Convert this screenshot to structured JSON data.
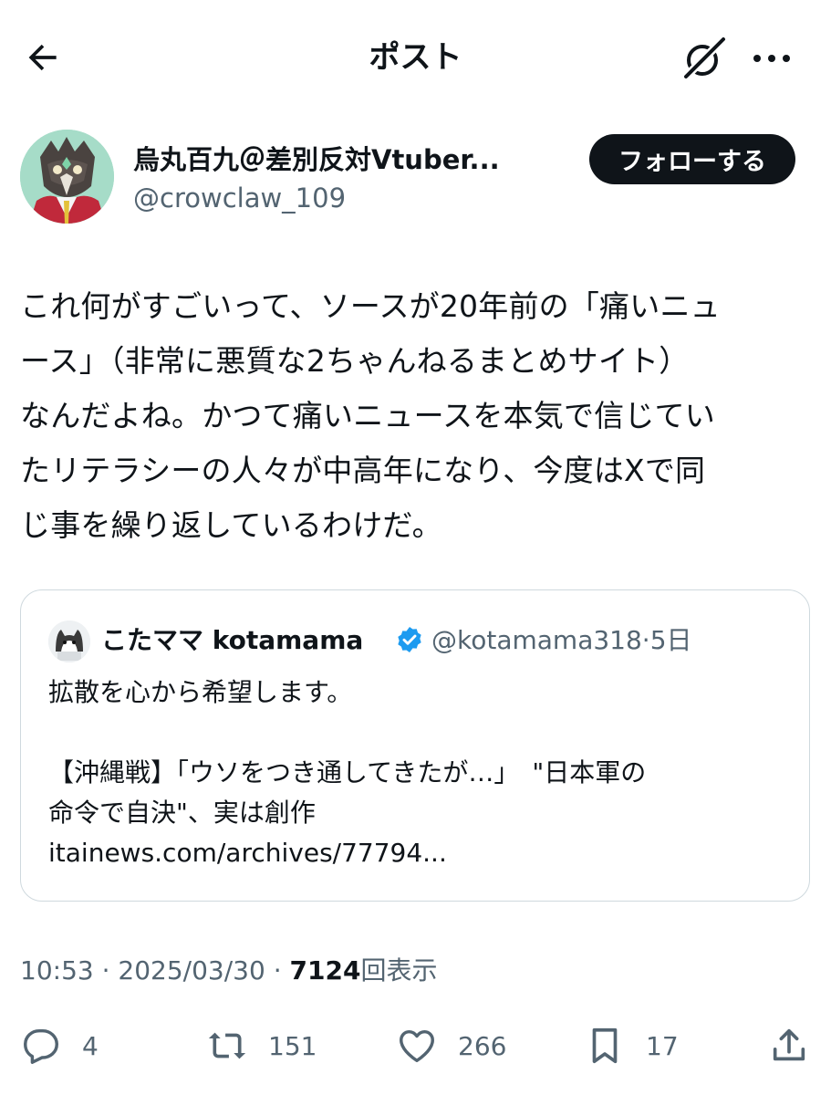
{
  "header": {
    "title": "ポスト"
  },
  "author": {
    "display_name": "烏丸百九＠差別反対Vtuber...",
    "handle": "@crowclaw_109",
    "follow_label": "フォローする"
  },
  "tweet": {
    "lines": [
      "これ何がすごいって、ソースが20年前の「痛いニュ",
      "ース」（非常に悪質な2ちゃんねるまとめサイト）",
      "なんだよね。かつて痛いニュースを本気で信じてい",
      "たリテラシーの人々が中高年になり、今度はXで同",
      "じ事を繰り返しているわけだ。"
    ]
  },
  "quote": {
    "name": "こたママ kotamama",
    "handle": "@kotamama318",
    "separator": "·",
    "time": "5日",
    "lines": [
      "拡散を心から希望します。",
      "",
      "【沖縄戦】「ウソをつき通してきたが…」　\"日本軍の",
      "命令で自決\"、実は創作",
      "itainews.com/archives/77794..."
    ]
  },
  "meta": {
    "time": "10:53",
    "sep1": "·",
    "date": "2025/03/30",
    "sep2": "·",
    "views": "7124",
    "views_label": "回表示"
  },
  "actions": {
    "replies": "4",
    "reposts": "151",
    "likes": "266",
    "bookmarks": "17"
  },
  "colors": {
    "text": "#0f1419",
    "secondary": "#536471",
    "border": "#cfd9de",
    "verified": "#1d9bf0"
  }
}
